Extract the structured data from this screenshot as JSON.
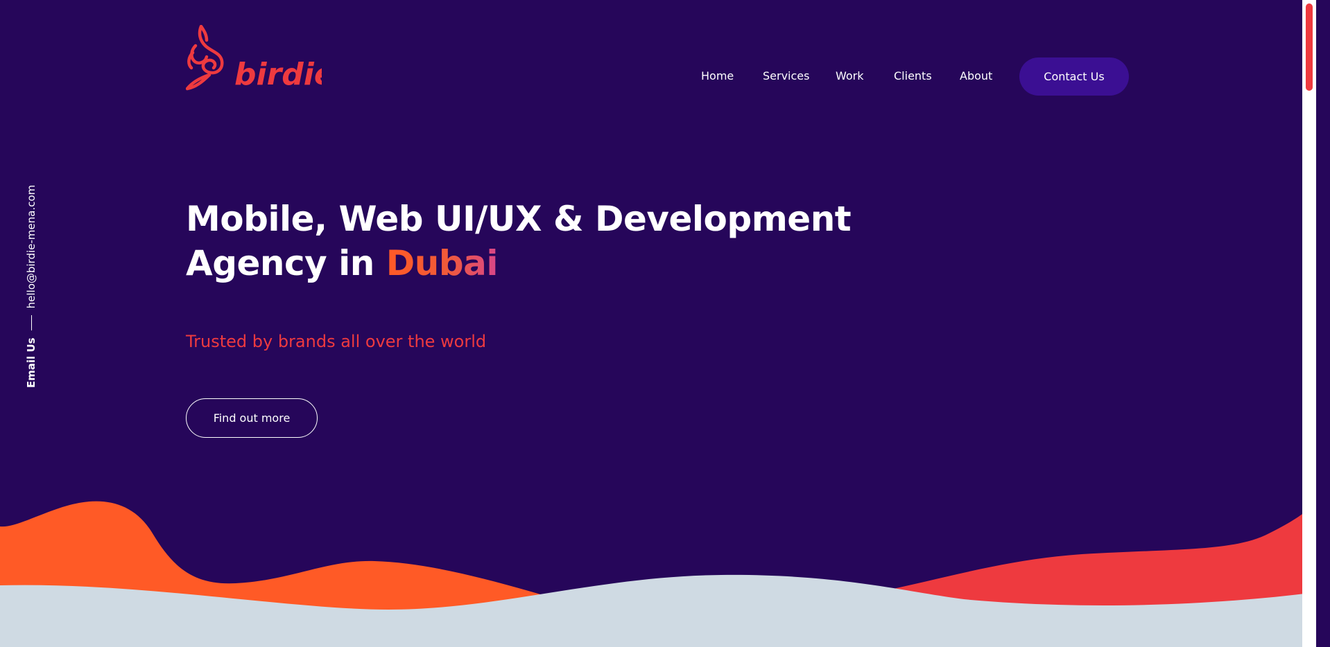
{
  "brand": {
    "logo_text": "birdie",
    "logo_color": "#ee3a3f"
  },
  "nav": {
    "items": [
      {
        "label": "Home"
      },
      {
        "label": "Services"
      },
      {
        "label": "Work"
      },
      {
        "label": "Clients"
      },
      {
        "label": "About"
      }
    ],
    "contact_label": "Contact Us"
  },
  "side": {
    "email_label": "Email Us",
    "email_address": "hello@birdie-mena.com"
  },
  "hero": {
    "title_line1": "Mobile, Web UI/UX & Development",
    "title_line2_prefix": "Agency in ",
    "title_line2_accent": "Dubai",
    "tagline": "Trusted by brands all over the world",
    "cta_label": "Find out more"
  },
  "colors": {
    "background": "#26065a",
    "contact_button": "#3b0f93",
    "accent_red": "#ee3a3f",
    "accent_orange": "#ff5a26",
    "wave_light": "#cfdae3"
  }
}
